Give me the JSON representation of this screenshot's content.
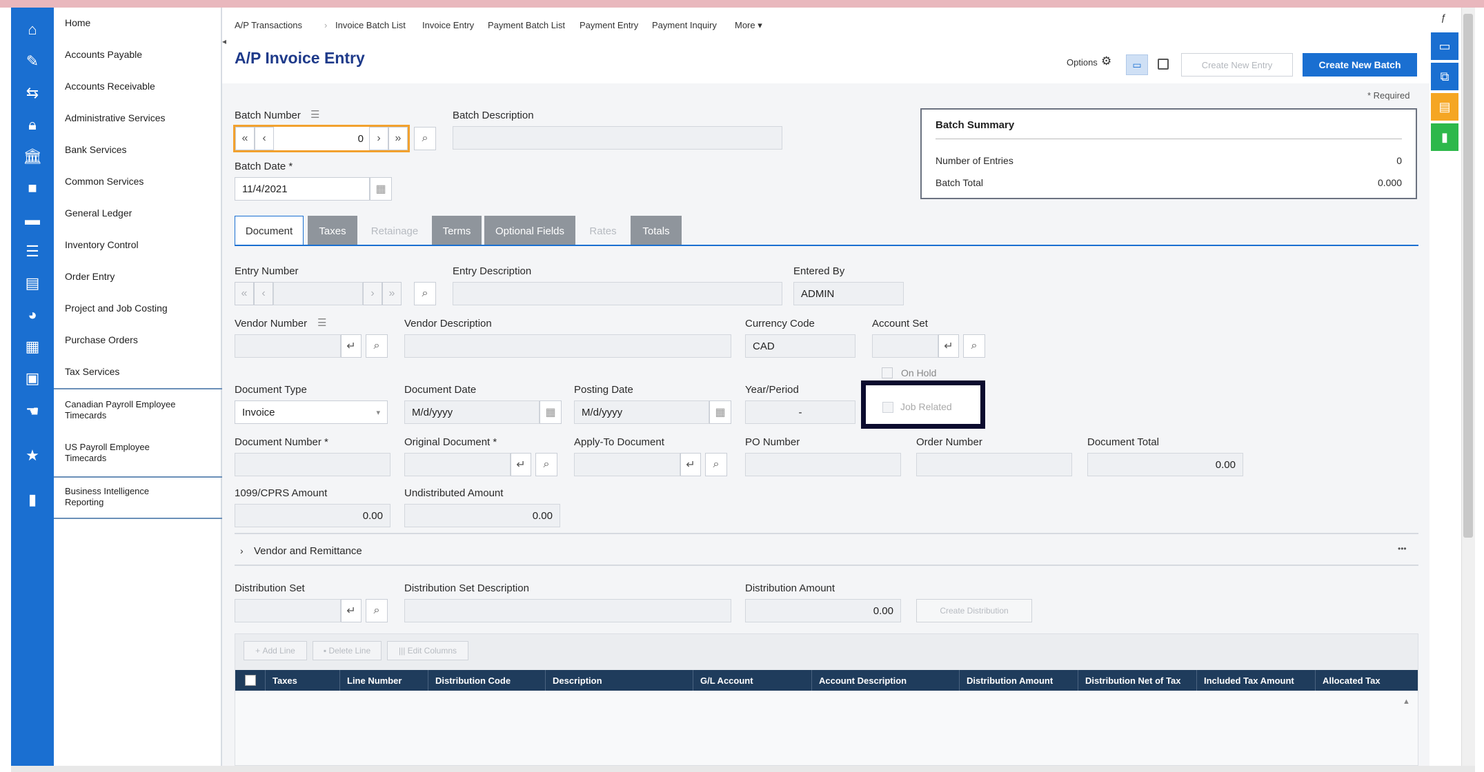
{
  "nav": {
    "items": [
      {
        "label": "Home",
        "icon": "home-icon"
      },
      {
        "label": "Accounts Payable",
        "icon": "accounts-payable-icon"
      },
      {
        "label": "Accounts Receivable",
        "icon": "accounts-receivable-icon"
      },
      {
        "label": "Administrative Services",
        "icon": "lock-icon"
      },
      {
        "label": "Bank Services",
        "icon": "bank-icon"
      },
      {
        "label": "Common Services",
        "icon": "briefcase-icon"
      },
      {
        "label": "General Ledger",
        "icon": "folder-icon"
      },
      {
        "label": "Inventory Control",
        "icon": "inventory-icon"
      },
      {
        "label": "Order Entry",
        "icon": "order-icon"
      },
      {
        "label": "Project and Job Costing",
        "icon": "pie-chart-icon"
      },
      {
        "label": "Purchase Orders",
        "icon": "purchase-icon"
      },
      {
        "label": "Tax Services",
        "icon": "tax-icon"
      },
      {
        "label": "Canadian Payroll Employee Timecards",
        "icon": "payroll-icon"
      },
      {
        "label": "US Payroll Employee Timecards",
        "icon": "star-icon"
      },
      {
        "label": "Business Intelligence Reporting",
        "icon": "bar-chart-icon"
      }
    ]
  },
  "breadcrumb": [
    "A/P Transactions",
    "Invoice Batch List",
    "Invoice Entry",
    "Payment Batch List",
    "Payment Entry",
    "Payment Inquiry",
    "More ▾"
  ],
  "page": {
    "title": "A/P Invoice Entry",
    "required_note": "* Required"
  },
  "toolbar": {
    "options_label": "Options",
    "create_new_entry": "Create New Entry",
    "create_new_batch": "Create New Batch"
  },
  "batch": {
    "number_label": "Batch Number",
    "number_value": "0",
    "description_label": "Batch Description",
    "description_value": "",
    "date_label": "Batch Date *",
    "date_value": "11/4/2021"
  },
  "summary": {
    "title": "Batch Summary",
    "entries_label": "Number of Entries",
    "entries_value": "0",
    "total_label": "Batch Total",
    "total_value": "0.000"
  },
  "tabs": [
    {
      "label": "Document",
      "state": "active"
    },
    {
      "label": "Taxes",
      "state": "dark"
    },
    {
      "label": "Retainage",
      "state": "dis"
    },
    {
      "label": "Terms",
      "state": "dark"
    },
    {
      "label": "Optional Fields",
      "state": "dark"
    },
    {
      "label": "Rates",
      "state": "dis"
    },
    {
      "label": "Totals",
      "state": "dark"
    }
  ],
  "entry": {
    "entry_number_label": "Entry Number",
    "entry_description_label": "Entry Description",
    "entered_by_label": "Entered By",
    "entered_by_value": "ADMIN",
    "vendor_number_label": "Vendor Number",
    "vendor_description_label": "Vendor Description",
    "currency_label": "Currency Code",
    "currency_value": "CAD",
    "account_set_label": "Account Set",
    "on_hold_label": "On Hold",
    "doc_type_label": "Document Type",
    "doc_type_value": "Invoice",
    "doc_date_label": "Document Date",
    "doc_date_value": "M/d/yyyy",
    "posting_date_label": "Posting Date",
    "posting_date_value": "M/d/yyyy",
    "year_period_label": "Year/Period",
    "year_period_value": "-",
    "job_related_label": "Job Related",
    "doc_number_label": "Document Number *",
    "orig_doc_label": "Original Document *",
    "apply_to_label": "Apply-To Document",
    "po_number_label": "PO Number",
    "order_number_label": "Order Number",
    "doc_total_label": "Document Total",
    "doc_total_value": "0.00",
    "cprs_label": "1099/CPRS Amount",
    "cprs_value": "0.00",
    "undistributed_label": "Undistributed Amount",
    "undistributed_value": "0.00"
  },
  "vendor_section": {
    "label": "Vendor and Remittance",
    "more": "•••"
  },
  "distribution": {
    "set_label": "Distribution Set",
    "set_desc_label": "Distribution Set Description",
    "amount_label": "Distribution Amount",
    "amount_value": "0.00",
    "create_label": "Create Distribution"
  },
  "grid": {
    "add_line": "Add Line",
    "delete_line": "Delete Line",
    "edit_columns": "Edit Columns",
    "columns": [
      "Taxes",
      "Line Number",
      "Distribution Code",
      "Description",
      "G/L Account",
      "Account Description",
      "Distribution Amount",
      "Distribution Net of Tax",
      "Included Tax Amount",
      "Allocated Tax"
    ]
  },
  "colors": {
    "brand_blue": "#1a6fd1",
    "dark_tab": "#8f959c",
    "grid_header": "#1f3c5c",
    "highlight": "#0b0b2e"
  }
}
